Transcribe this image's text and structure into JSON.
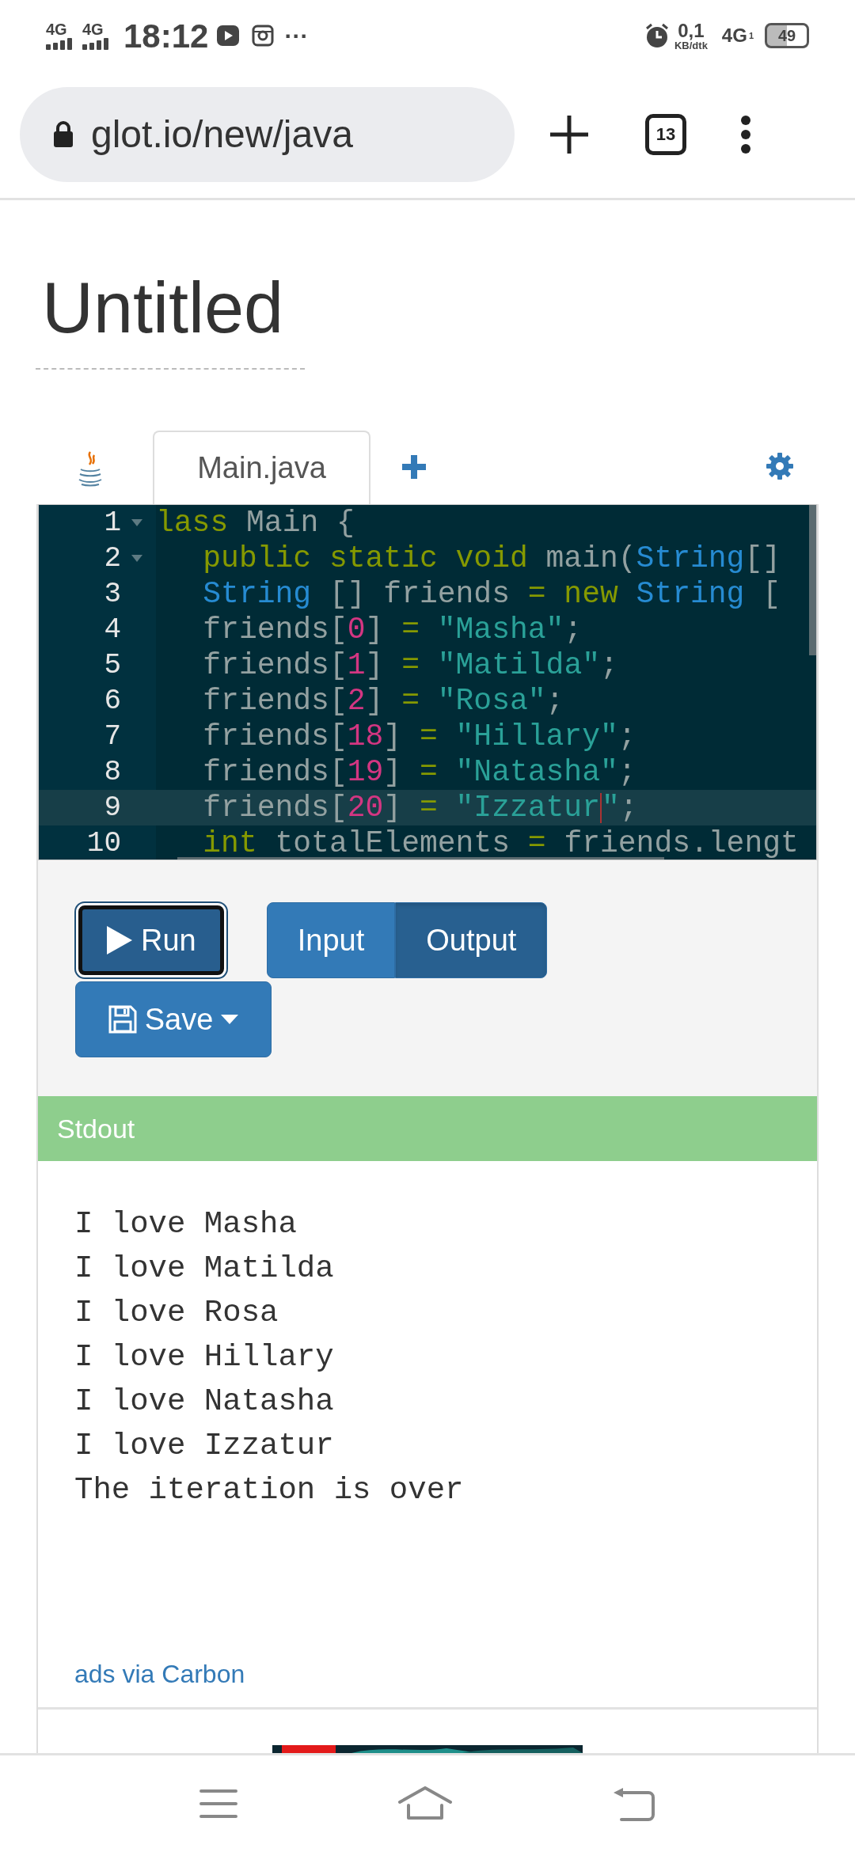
{
  "status_bar": {
    "signals": [
      {
        "label": "4G"
      },
      {
        "label": "4G"
      }
    ],
    "time": "18:12",
    "more": "···",
    "data_rate": "0,1",
    "data_unit": "KB/dtk",
    "network": "4G",
    "sim": "1",
    "battery": "49"
  },
  "browser": {
    "url": "glot.io/new/java",
    "tab_count": "13"
  },
  "title": "Untitled",
  "file_tabs": [
    {
      "label": "Main.java",
      "selected": true
    }
  ],
  "editor": {
    "lines": [
      {
        "number": "1",
        "fold": true,
        "active": false,
        "indented": false,
        "tokens": [
          {
            "text": "lass",
            "kind": "kw"
          },
          {
            "text": " Main {",
            "kind": "plain"
          }
        ]
      },
      {
        "number": "2",
        "fold": true,
        "active": false,
        "indented": true,
        "tokens": [
          {
            "text": "public static void",
            "kind": "kw"
          },
          {
            "text": " main(",
            "kind": "plain"
          },
          {
            "text": "String",
            "kind": "type"
          },
          {
            "text": "[] ",
            "kind": "plain"
          }
        ]
      },
      {
        "number": "3",
        "fold": false,
        "active": false,
        "indented": true,
        "tokens": [
          {
            "text": "String",
            "kind": "type"
          },
          {
            "text": " [] friends ",
            "kind": "plain"
          },
          {
            "text": "= new ",
            "kind": "kw"
          },
          {
            "text": "String",
            "kind": "type"
          },
          {
            "text": " [",
            "kind": "plain"
          }
        ]
      },
      {
        "number": "4",
        "fold": false,
        "active": false,
        "indented": true,
        "tokens": [
          {
            "text": "friends[",
            "kind": "plain"
          },
          {
            "text": "0",
            "kind": "num"
          },
          {
            "text": "] ",
            "kind": "plain"
          },
          {
            "text": "= ",
            "kind": "kw"
          },
          {
            "text": "\"Masha\"",
            "kind": "str"
          },
          {
            "text": ";",
            "kind": "plain"
          }
        ]
      },
      {
        "number": "5",
        "fold": false,
        "active": false,
        "indented": true,
        "tokens": [
          {
            "text": "friends[",
            "kind": "plain"
          },
          {
            "text": "1",
            "kind": "num"
          },
          {
            "text": "] ",
            "kind": "plain"
          },
          {
            "text": "= ",
            "kind": "kw"
          },
          {
            "text": "\"Matilda\"",
            "kind": "str"
          },
          {
            "text": ";",
            "kind": "plain"
          }
        ]
      },
      {
        "number": "6",
        "fold": false,
        "active": false,
        "indented": true,
        "tokens": [
          {
            "text": "friends[",
            "kind": "plain"
          },
          {
            "text": "2",
            "kind": "num"
          },
          {
            "text": "] ",
            "kind": "plain"
          },
          {
            "text": "= ",
            "kind": "kw"
          },
          {
            "text": "\"Rosa\"",
            "kind": "str"
          },
          {
            "text": ";",
            "kind": "plain"
          }
        ]
      },
      {
        "number": "7",
        "fold": false,
        "active": false,
        "indented": true,
        "tokens": [
          {
            "text": "friends[",
            "kind": "plain"
          },
          {
            "text": "18",
            "kind": "num"
          },
          {
            "text": "] ",
            "kind": "plain"
          },
          {
            "text": "= ",
            "kind": "kw"
          },
          {
            "text": "\"Hillary\"",
            "kind": "str"
          },
          {
            "text": ";",
            "kind": "plain"
          }
        ]
      },
      {
        "number": "8",
        "fold": false,
        "active": false,
        "indented": true,
        "tokens": [
          {
            "text": "friends[",
            "kind": "plain"
          },
          {
            "text": "19",
            "kind": "num"
          },
          {
            "text": "] ",
            "kind": "plain"
          },
          {
            "text": "= ",
            "kind": "kw"
          },
          {
            "text": "\"Natasha\"",
            "kind": "str"
          },
          {
            "text": ";",
            "kind": "plain"
          }
        ]
      },
      {
        "number": "9",
        "fold": false,
        "active": true,
        "indented": true,
        "tokens": [
          {
            "text": "friends[",
            "kind": "plain"
          },
          {
            "text": "20",
            "kind": "num"
          },
          {
            "text": "] ",
            "kind": "plain"
          },
          {
            "text": "= ",
            "kind": "kw"
          },
          {
            "text": "\"Izzatur",
            "kind": "str"
          },
          {
            "kind": "cursor"
          },
          {
            "text": "\"",
            "kind": "str"
          },
          {
            "text": ";",
            "kind": "plain"
          }
        ]
      },
      {
        "number": "10",
        "fold": false,
        "active": false,
        "indented": true,
        "tokens": [
          {
            "text": "int",
            "kind": "kw"
          },
          {
            "text": " totalElements ",
            "kind": "plain"
          },
          {
            "text": "=",
            "kind": "kw"
          },
          {
            "text": " friends.lengt",
            "kind": "plain"
          }
        ]
      }
    ]
  },
  "toolbar": {
    "run": "Run",
    "views": [
      {
        "label": "Input",
        "selected": false
      },
      {
        "label": "Output",
        "selected": true
      }
    ],
    "save": "Save"
  },
  "output": {
    "header": "Stdout",
    "lines": [
      "I love Masha",
      "I love Matilda",
      "I love Rosa",
      "I love Hillary",
      "I love Natasha",
      "I love Izzatur",
      "The iteration is over"
    ]
  },
  "ads_link": "ads via Carbon"
}
